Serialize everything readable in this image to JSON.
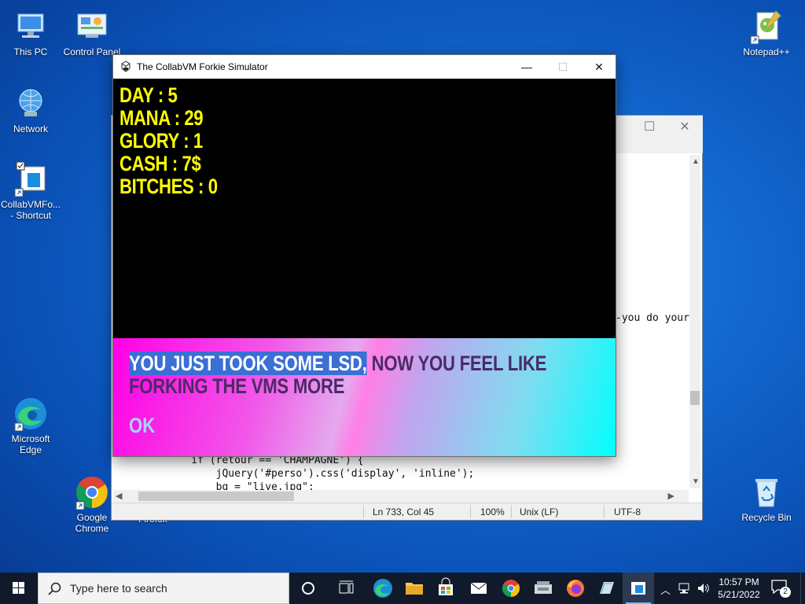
{
  "desktop": {
    "icons": [
      {
        "label": "This PC"
      },
      {
        "label": "Control Panel"
      },
      {
        "label": "Network"
      },
      {
        "label": "CollabVMFo... - Shortcut"
      },
      {
        "label": "Microsoft Edge"
      },
      {
        "label": "Google Chrome"
      },
      {
        "label": "Notepad++"
      },
      {
        "label": "Recycle Bin"
      }
    ],
    "hidden_label": "Firefox"
  },
  "notepad": {
    "code_snippet_right": "-you do your",
    "code_lines": [
      "    if (retour == 'CHAMPAGNE') {",
      "        jQuery('#perso').css('display', 'inline');",
      "        bg = \"live.jpg\";"
    ],
    "status": {
      "position": "Ln 733, Col 45",
      "zoom": "100%",
      "eol": "Unix (LF)",
      "encoding": "UTF-8"
    }
  },
  "game": {
    "title": "The CollabVM Forkie Simulator",
    "stats": {
      "day": "DAY : 5",
      "mana": "MANA : 29",
      "glory": "GLORY : 1",
      "cash": "CASH : 7$",
      "bitches": "BITCHES : 0"
    },
    "message_selected": "YOU JUST TOOK SOME LSD,",
    "message_rest_line1": " NOW YOU FEEL LIKE",
    "message_line2": "FORKING THE VMS MORE",
    "ok_label": "OK"
  },
  "taskbar": {
    "search_placeholder": "Type here to search",
    "time": "10:57 PM",
    "date": "5/21/2022",
    "notification_count": "2"
  }
}
